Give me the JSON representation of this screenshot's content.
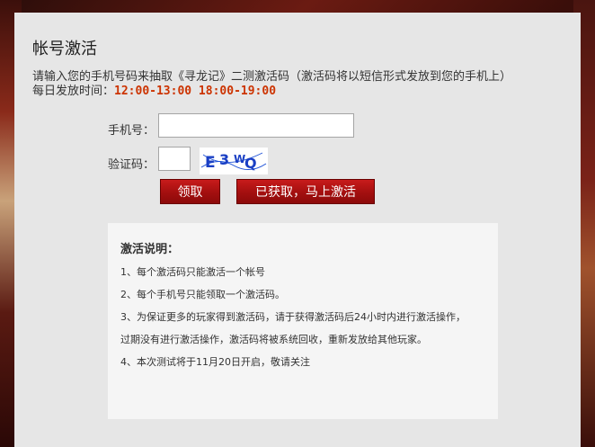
{
  "panel": {
    "title": "帐号激活",
    "intro_line1": "请输入您的手机号码来抽取《寻龙记》二测激活码（激活码将以短信形式发放到您的手机上）",
    "intro_line2_prefix": "每日发放时间：",
    "intro_line2_times": "12:00-13:00 18:00-19:00"
  },
  "form": {
    "phone_label": "手机号：",
    "phone_value": "",
    "code_label": "验证码：",
    "code_value": "",
    "captcha_text": "E3WQ",
    "claim_button": "领取",
    "activate_button": "已获取，马上激活"
  },
  "notes": {
    "title": "激活说明：",
    "items": [
      "1、每个激活码只能激活一个帐号",
      "2、每个手机号只能领取一个激活码。",
      "3、为保证更多的玩家得到激活码，请于获得激活码后24小时内进行激活操作，",
      "过期没有进行激活操作，激活码将被系统回收，重新发放给其他玩家。",
      "4、本次测试将于11月20日开启，敬请关注"
    ]
  },
  "colors": {
    "panel_bg": "#e6e6e6",
    "button_red": "#b01414",
    "time_highlight": "#cc3300"
  }
}
